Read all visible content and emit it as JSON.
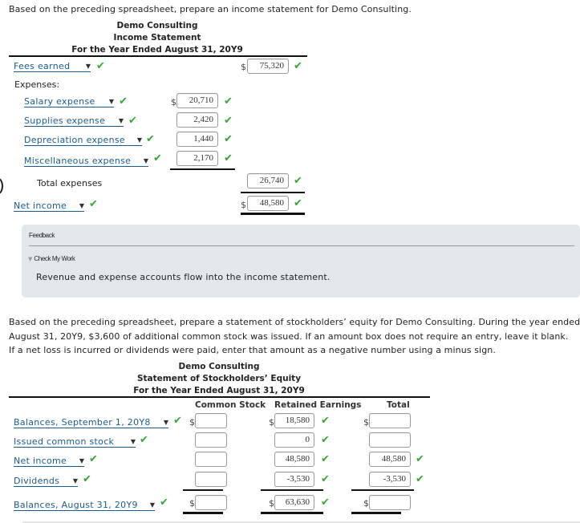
{
  "income_statement": {
    "instruction": "Based on the preceding spreadsheet, prepare an income statement for Demo Consulting.",
    "header": {
      "company": "Demo Consulting",
      "title": "Income Statement",
      "period": "For the Year Ended August 31, 20Y9"
    },
    "revenue": {
      "account": "Fees earned",
      "amount": "75,320",
      "status": "correct"
    },
    "expenses_label": "Expenses:",
    "expenses": [
      {
        "account": "Salary expense",
        "amount": "20,710",
        "status": "correct"
      },
      {
        "account": "Supplies expense",
        "amount": "2,420",
        "status": "correct"
      },
      {
        "account": "Depreciation expense",
        "amount": "1,440",
        "status": "correct"
      },
      {
        "account": "Miscellaneous expense",
        "amount": "2,170",
        "status": "correct"
      }
    ],
    "total_expenses": {
      "label": "Total expenses",
      "amount": "26,740",
      "status": "correct"
    },
    "net_income": {
      "account": "Net income",
      "amount": "48,580",
      "status": "correct"
    },
    "currency_symbol": "$"
  },
  "feedback": {
    "title": "Feedback",
    "toggle_label": "Check My Work",
    "message": "Revenue and expense accounts flow into the income statement."
  },
  "equity_statement": {
    "instruction_lines": [
      "Based on the preceding spreadsheet, prepare a statement of stockholders’ equity for Demo Consulting. During the year ended",
      "August 31, 20Y9, $3,600 of additional common stock was issued. If an amount box does not require an entry, leave it blank.",
      "If a net loss is incurred or dividends were paid, enter that amount as a negative number using a minus sign."
    ],
    "header": {
      "company": "Demo Consulting",
      "title": "Statement of Stockholders’ Equity",
      "period": "For the Year Ended August 31, 20Y9"
    },
    "columns": [
      "Common Stock",
      "Retained Earnings",
      "Total"
    ],
    "rows": [
      {
        "account": "Balances, September 1, 20Y8",
        "common_stock": "",
        "retained_earnings": "18,580",
        "re_status": "correct",
        "total": "",
        "total_status": ""
      },
      {
        "account": "Issued common stock",
        "common_stock": "",
        "retained_earnings": "0",
        "re_status": "correct",
        "total": "",
        "total_status": ""
      },
      {
        "account": "Net income",
        "common_stock": "",
        "retained_earnings": "48,580",
        "re_status": "correct",
        "total": "48,580",
        "total_status": "correct"
      },
      {
        "account": "Dividends",
        "common_stock": "",
        "retained_earnings": "-3,530",
        "re_status": "correct",
        "total": "-3,530",
        "total_status": "correct"
      },
      {
        "account": "Balances, August 31, 20Y9",
        "common_stock": "",
        "retained_earnings": "63,630",
        "re_status": "correct",
        "total": "",
        "total_status": ""
      }
    ],
    "currency_symbol": "$"
  },
  "icons": {
    "check": "✔",
    "caret": "▼",
    "collapse_triangle": "▼"
  },
  "colors": {
    "link": "#1c5b8f",
    "check": "#3aa53a",
    "feedback_bg": "#e2e7eb"
  }
}
